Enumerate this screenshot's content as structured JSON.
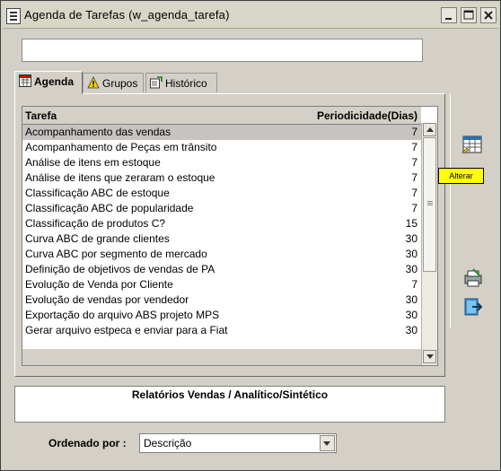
{
  "window": {
    "title": "Agenda de Tarefas (w_agenda_tarefa)"
  },
  "tabs": [
    {
      "label": "Agenda"
    },
    {
      "label": "Grupos"
    },
    {
      "label": "Histórico"
    }
  ],
  "table": {
    "columns": [
      "Tarefa",
      "Periodicidade(Dias)"
    ],
    "rows": [
      {
        "tarefa": "Acompanhamento das vendas",
        "periodicidade": "7"
      },
      {
        "tarefa": "Acompanhamento de Peças em trânsito",
        "periodicidade": "7"
      },
      {
        "tarefa": "Análise de itens em estoque",
        "periodicidade": "7"
      },
      {
        "tarefa": "Análise de itens que zeraram o estoque",
        "periodicidade": "7"
      },
      {
        "tarefa": "Classificação ABC de estoque",
        "periodicidade": "7"
      },
      {
        "tarefa": "Classificação ABC de popularidade",
        "periodicidade": "7"
      },
      {
        "tarefa": "Classificação de produtos C?",
        "periodicidade": "15"
      },
      {
        "tarefa": "Curva ABC de grande clientes",
        "periodicidade": "30"
      },
      {
        "tarefa": "Curva ABC por segmento de mercado",
        "periodicidade": "30"
      },
      {
        "tarefa": "Definição de objetivos de vendas de PA",
        "periodicidade": "30"
      },
      {
        "tarefa": "Evolução de Venda por Cliente",
        "periodicidade": "7"
      },
      {
        "tarefa": "Evolução de vendas por vendedor",
        "periodicidade": "30"
      },
      {
        "tarefa": "Exportação do arquivo ABS projeto MPS",
        "periodicidade": "30"
      },
      {
        "tarefa": "Gerar arquivo estpeca e enviar para a Fiat",
        "periodicidade": "30"
      }
    ]
  },
  "tooltip": {
    "text": "Alterar"
  },
  "description": {
    "text": "Relatórios Vendas / Analítico/Sintético"
  },
  "order": {
    "label": "Ordenado por :",
    "value": "Descrição"
  },
  "colors": {
    "selected_row": "#c6c3c0",
    "tooltip_bg": "#ffff00"
  }
}
